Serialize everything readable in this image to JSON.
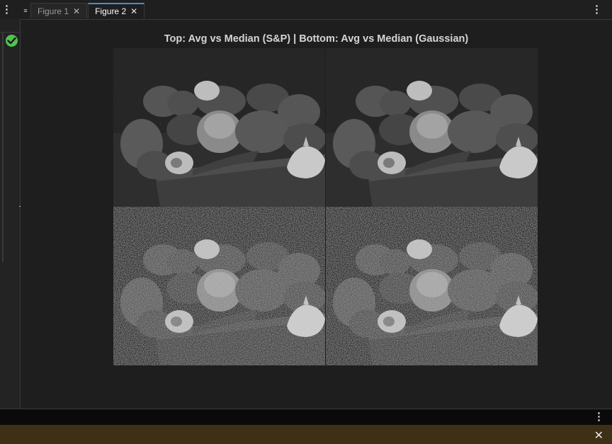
{
  "app": {
    "tabs": [
      {
        "label": "Figure 1",
        "active": false
      },
      {
        "label": "Figure 2",
        "active": true
      }
    ],
    "status": "ok",
    "accent": "#3e8ee0",
    "notification_color": "#3e3016"
  },
  "figure": {
    "title": "Top: Avg vs Median (S&P) | Bottom: Avg vs Median (Gaussian)",
    "panels": [
      {
        "name": "avg-filtered-saltpepper",
        "noise": "salt-and-pepper"
      },
      {
        "name": "median-filtered-saltpepper",
        "noise": "none"
      },
      {
        "name": "avg-filtered-gaussian",
        "noise": "gaussian"
      },
      {
        "name": "median-filtered-gaussian",
        "noise": "gaussian"
      }
    ]
  },
  "icons": {
    "menu": "kebab-vertical-icon",
    "tab_close": "close-icon",
    "status": "check-circle-icon",
    "drag": "drag-handle-icon"
  }
}
